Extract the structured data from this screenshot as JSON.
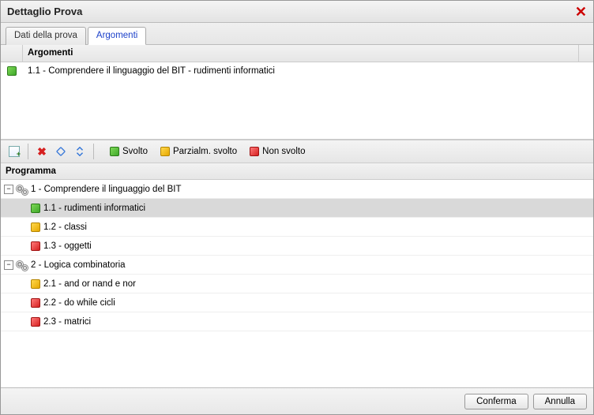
{
  "title": "Dettaglio Prova",
  "tabs": [
    {
      "label": "Dati della prova",
      "active": false
    },
    {
      "label": "Argomenti",
      "active": true
    }
  ],
  "argomenti": {
    "header": "Argomenti",
    "rows": [
      {
        "iconColor": "green",
        "text": "1.1 - Comprendere il linguaggio del BIT - rudimenti informatici"
      }
    ]
  },
  "legend": {
    "svolto": "Svolto",
    "parzialm": "Parzialm. svolto",
    "nonsvolto": "Non svolto"
  },
  "programma": {
    "header": "Programma",
    "units": [
      {
        "expanded": true,
        "label": "1 - Comprendere il linguaggio del BIT",
        "children": [
          {
            "status": "green",
            "label": "1.1 - rudimenti informatici",
            "selected": true
          },
          {
            "status": "yellow",
            "label": "1.2 - classi",
            "selected": false
          },
          {
            "status": "red",
            "label": "1.3 - oggetti",
            "selected": false
          }
        ]
      },
      {
        "expanded": true,
        "label": "2 - Logica combinatoria",
        "children": [
          {
            "status": "yellow",
            "label": "2.1 - and or nand e nor",
            "selected": false
          },
          {
            "status": "red",
            "label": "2.2 - do while cicli",
            "selected": false
          },
          {
            "status": "red",
            "label": "2.3 - matrici",
            "selected": false
          }
        ]
      }
    ]
  },
  "buttons": {
    "confirm": "Conferma",
    "cancel": "Annulla"
  }
}
